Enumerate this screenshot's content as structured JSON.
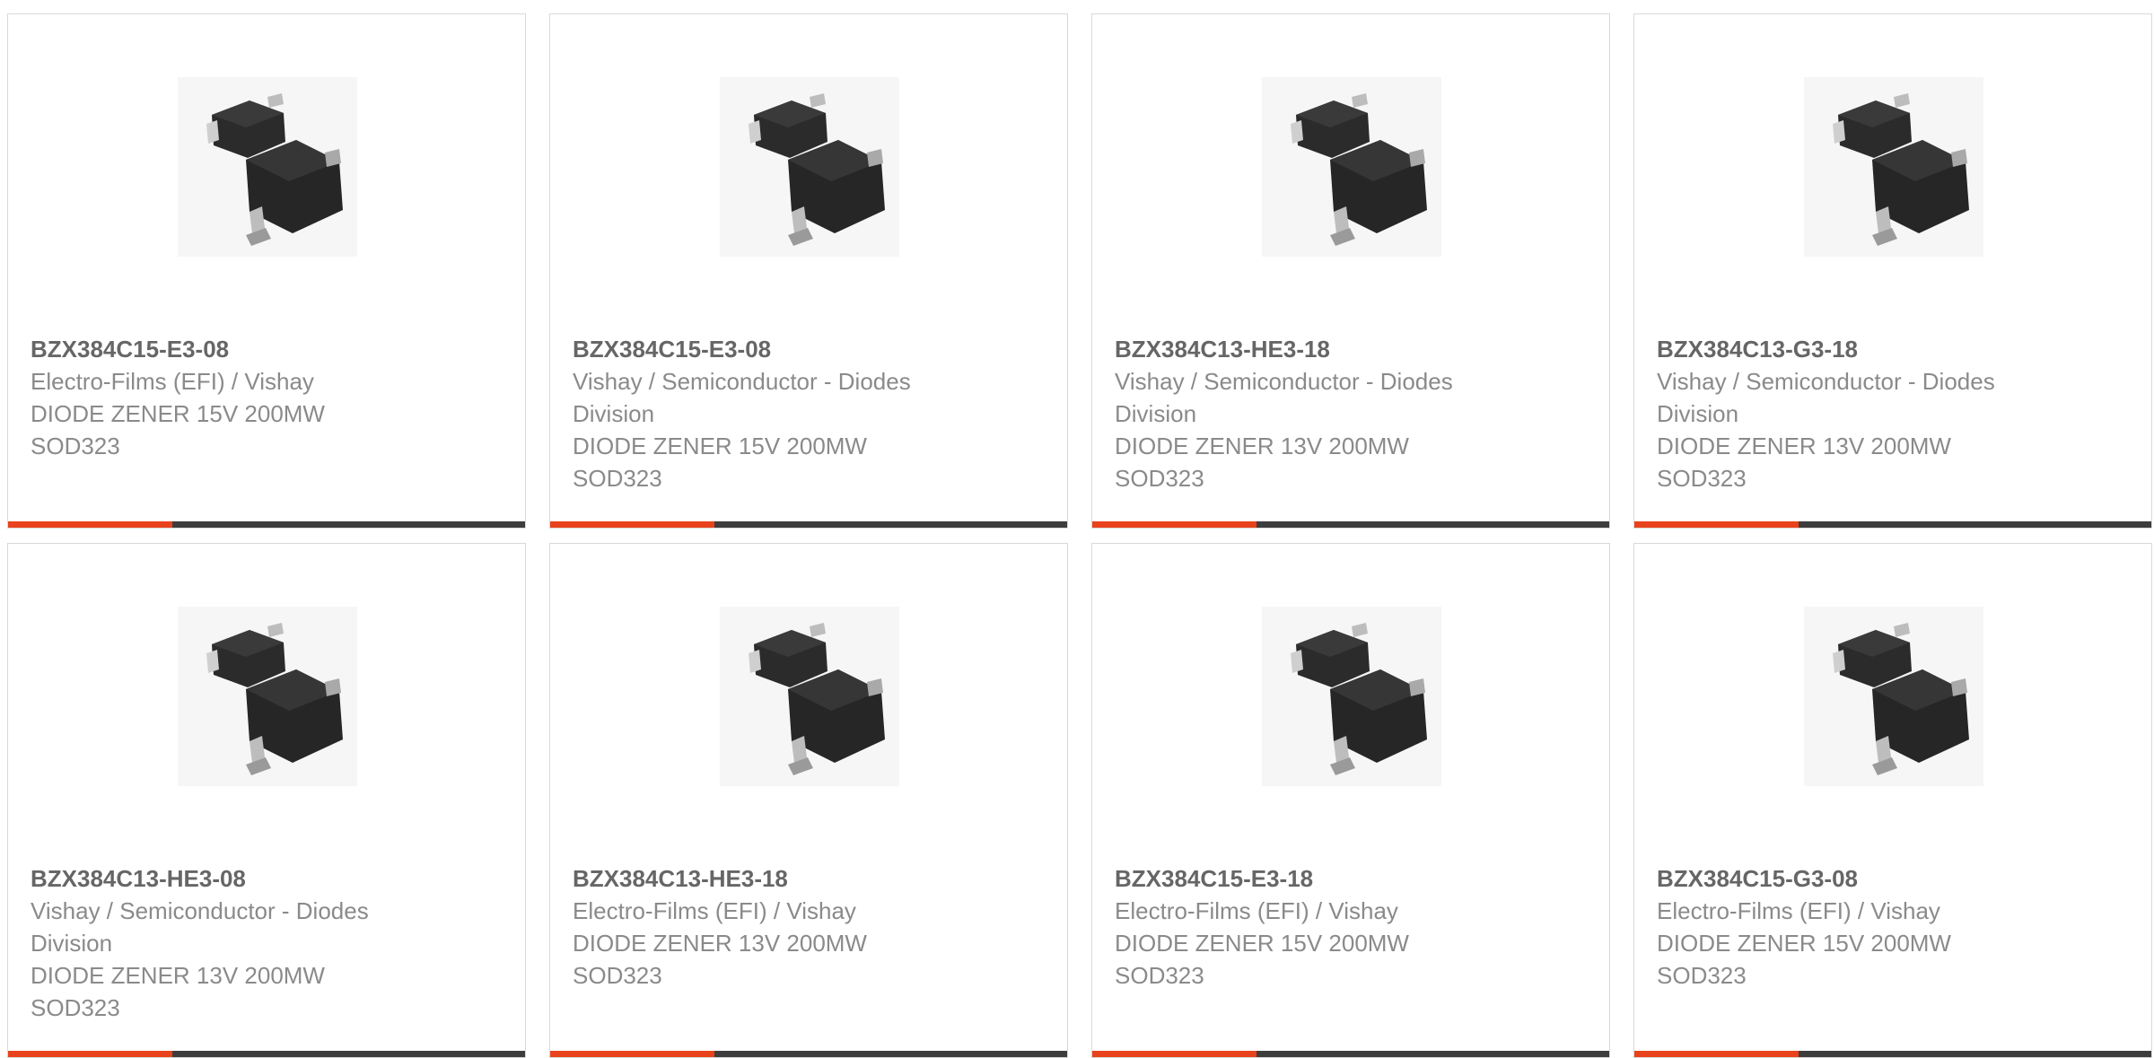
{
  "colors": {
    "accent": "#e8431c",
    "bar": "#3d3d3d",
    "part_number": "#666666",
    "detail_text": "#8a8a8a",
    "border": "#d9d9d9"
  },
  "products": [
    {
      "part_number": "BZX384C15-E3-08",
      "manufacturer": [
        "Electro-Films (EFI) / Vishay"
      ],
      "description": [
        "DIODE ZENER 15V 200MW",
        "SOD323"
      ],
      "image_icon": "sod323-diode-image"
    },
    {
      "part_number": "BZX384C15-E3-08",
      "manufacturer": [
        "Vishay / Semiconductor - Diodes",
        "Division"
      ],
      "description": [
        "DIODE ZENER 15V 200MW",
        "SOD323"
      ],
      "image_icon": "sod323-diode-image"
    },
    {
      "part_number": "BZX384C13-HE3-18",
      "manufacturer": [
        "Vishay / Semiconductor - Diodes",
        "Division"
      ],
      "description": [
        "DIODE ZENER 13V 200MW",
        "SOD323"
      ],
      "image_icon": "sod323-diode-image"
    },
    {
      "part_number": "BZX384C13-G3-18",
      "manufacturer": [
        "Vishay / Semiconductor - Diodes",
        "Division"
      ],
      "description": [
        "DIODE ZENER 13V 200MW",
        "SOD323"
      ],
      "image_icon": "sod323-diode-image"
    },
    {
      "part_number": "BZX384C13-HE3-08",
      "manufacturer": [
        "Vishay / Semiconductor - Diodes",
        "Division"
      ],
      "description": [
        "DIODE ZENER 13V 200MW",
        "SOD323"
      ],
      "image_icon": "sod323-diode-image"
    },
    {
      "part_number": "BZX384C13-HE3-18",
      "manufacturer": [
        "Electro-Films (EFI) / Vishay"
      ],
      "description": [
        "DIODE ZENER 13V 200MW",
        "SOD323"
      ],
      "image_icon": "sod323-diode-image"
    },
    {
      "part_number": "BZX384C15-E3-18",
      "manufacturer": [
        "Electro-Films (EFI) / Vishay"
      ],
      "description": [
        "DIODE ZENER 15V 200MW",
        "SOD323"
      ],
      "image_icon": "sod323-diode-image"
    },
    {
      "part_number": "BZX384C15-G3-08",
      "manufacturer": [
        "Electro-Films (EFI) / Vishay"
      ],
      "description": [
        "DIODE ZENER 15V 200MW",
        "SOD323"
      ],
      "image_icon": "sod323-diode-image"
    }
  ]
}
